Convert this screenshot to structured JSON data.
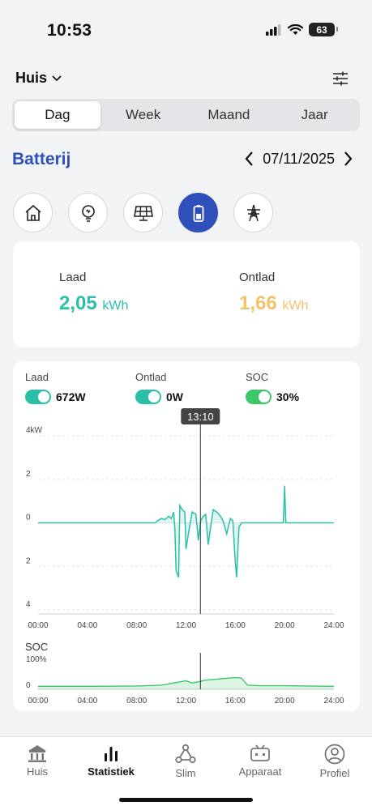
{
  "status": {
    "time": "10:53",
    "battery": "63"
  },
  "header": {
    "home": "Huis"
  },
  "tabs": [
    "Dag",
    "Week",
    "Maand",
    "Jaar"
  ],
  "section": {
    "title": "Batterij",
    "date": "07/11/2025"
  },
  "categories": [
    "home-icon",
    "bulb-icon",
    "solar-panel-icon",
    "battery-icon",
    "grid-tower-icon"
  ],
  "summary": {
    "charge": {
      "label": "Laad",
      "value": "2,05",
      "unit": "kWh",
      "color": "#2bbfa8"
    },
    "discharge": {
      "label": "Ontlad",
      "value": "1,66",
      "unit": "kWh",
      "color": "#f5c26b"
    }
  },
  "legend": [
    {
      "label": "Laad",
      "value": "672W",
      "color": "#2bbfa8"
    },
    {
      "label": "Ontlad",
      "value": "0W",
      "color": "#2bbfa8"
    },
    {
      "label": "SOC",
      "value": "30%",
      "color": "#3cc86a"
    }
  ],
  "chart_data": [
    {
      "type": "line",
      "yunit": "4kW",
      "y_tick_labels": [
        "4kW",
        "2",
        "0",
        "2",
        "4"
      ],
      "x_tick_labels": [
        "00:00",
        "04:00",
        "08:00",
        "12:00",
        "16:00",
        "20:00",
        "24:00"
      ],
      "ylim": [
        -4,
        4
      ],
      "cursor_label": "13:10",
      "cursor_hour": 13.17,
      "series": [
        {
          "color": "#2bbfa8",
          "x": [
            0,
            9.5,
            9.7,
            10.0,
            10.3,
            10.6,
            10.8,
            11.0,
            11.1,
            11.2,
            11.4,
            11.5,
            11.7,
            11.9,
            12.0,
            12.2,
            12.5,
            12.8,
            13.0,
            13.2,
            13.4,
            13.6,
            13.8,
            14.0,
            14.2,
            14.5,
            14.8,
            15.0,
            15.3,
            15.6,
            15.8,
            16.0,
            16.1,
            16.3,
            16.5,
            16.8,
            17.0,
            17.3,
            19.9,
            20.0,
            20.1,
            20.2,
            24
          ],
          "y": [
            0,
            0,
            0.1,
            0.2,
            0.15,
            0.3,
            0.2,
            0.5,
            -0.3,
            -2.2,
            -2.5,
            0.8,
            0.6,
            0.5,
            -1.2,
            -0.5,
            0.5,
            0.4,
            -0.8,
            0.1,
            0.3,
            0.4,
            -1.0,
            -0.2,
            0.6,
            0.5,
            0.3,
            0.1,
            -0.5,
            0.2,
            0.1,
            -1.8,
            -2.5,
            -0.2,
            0.0,
            0.0,
            0.0,
            0.0,
            0.0,
            1.7,
            0.0,
            0.0,
            0
          ]
        }
      ]
    },
    {
      "type": "area",
      "title": "SOC",
      "y_tick_labels": [
        "100%",
        "0"
      ],
      "x_tick_labels": [
        "00:00",
        "04:00",
        "08:00",
        "12:00",
        "16:00",
        "20:00",
        "24:00"
      ],
      "ylim": [
        0,
        100
      ],
      "series": [
        {
          "color": "#3cc86a",
          "x": [
            0,
            4,
            8,
            10,
            11,
            12,
            12.5,
            13.0,
            13.5,
            14,
            15,
            16,
            16.5,
            17,
            18,
            20,
            22,
            24
          ],
          "y": [
            8,
            8,
            9,
            12,
            20,
            28,
            20,
            24,
            30,
            32,
            36,
            40,
            38,
            12,
            10,
            10,
            9,
            8
          ]
        }
      ]
    }
  ],
  "nav": [
    {
      "label": "Huis",
      "icon": "house-icon"
    },
    {
      "label": "Statistiek",
      "icon": "bar-chart-icon"
    },
    {
      "label": "Slim",
      "icon": "network-icon"
    },
    {
      "label": "Apparaat",
      "icon": "device-icon"
    },
    {
      "label": "Profiel",
      "icon": "profile-icon"
    }
  ]
}
